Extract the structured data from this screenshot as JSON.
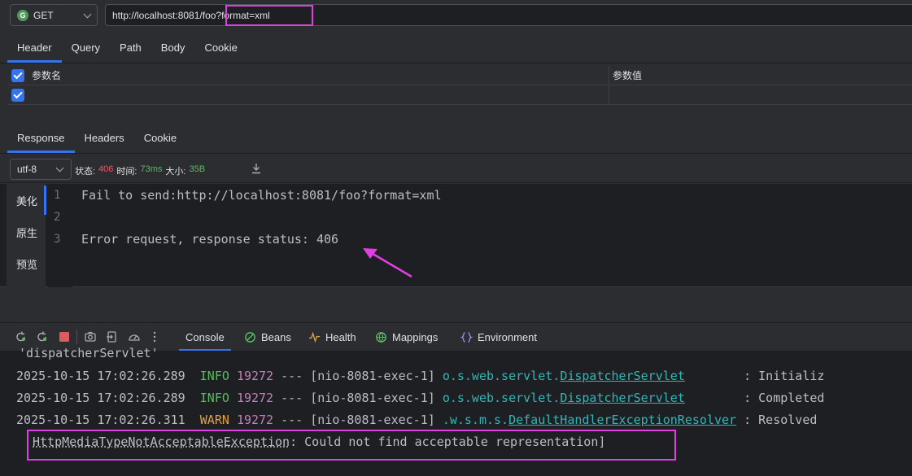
{
  "request": {
    "method": "GET",
    "method_badge": "G",
    "url": "http://localhost:8081/foo?format=xml"
  },
  "request_tabs": [
    "Header",
    "Query",
    "Path",
    "Body",
    "Cookie"
  ],
  "params": {
    "name_header": "参数名",
    "value_header": "参数值"
  },
  "response_tabs": [
    "Response",
    "Headers",
    "Cookie"
  ],
  "response_meta": {
    "encoding": "utf-8",
    "status_label": "状态:",
    "status_value": "406",
    "time_label": "时间:",
    "time_value": "73ms",
    "size_label": "大小:",
    "size_value": "35B"
  },
  "view_modes": [
    "美化",
    "原生",
    "预览"
  ],
  "response_lines": [
    {
      "num": "1",
      "text": "Fail to send:http://localhost:8081/foo?format=xml"
    },
    {
      "num": "2",
      "text": ""
    },
    {
      "num": "3",
      "text": "Error request, response status: 406"
    }
  ],
  "console_tabs": [
    "Console",
    "Beans",
    "Health",
    "Mappings",
    "Environment"
  ],
  "console_lines": {
    "line0": " 'dispatcherServlet'",
    "rows": [
      {
        "ts": "2025-10-15 17:02:26.289",
        "level": "INFO",
        "pid": "19272",
        "sep": "---",
        "thread": "[nio-8081-exec-1]",
        "pkg": "o.s.web.servlet.",
        "cls": "DispatcherServlet",
        "msg": ": Initializ"
      },
      {
        "ts": "2025-10-15 17:02:26.289",
        "level": "INFO",
        "pid": "19272",
        "sep": "---",
        "thread": "[nio-8081-exec-1]",
        "pkg": "o.s.web.servlet.",
        "cls": "DispatcherServlet",
        "msg": ": Completed"
      },
      {
        "ts": "2025-10-15 17:02:26.311",
        "level": "WARN",
        "pid": "19272",
        "sep": "---",
        "thread": "[nio-8081-exec-1]",
        "pkg": ".w.s.m.s.",
        "cls": "DefaultHandlerExceptionResolver",
        "msg": ": Resolved"
      }
    ],
    "exception": "HttpMediaTypeNotAcceptableException",
    "exception_msg": ": Could not find acceptable representation]"
  },
  "colors": {
    "accent": "#3574f0",
    "highlight": "#e040e0",
    "status_error": "#f75464",
    "ok": "#5fb865"
  }
}
